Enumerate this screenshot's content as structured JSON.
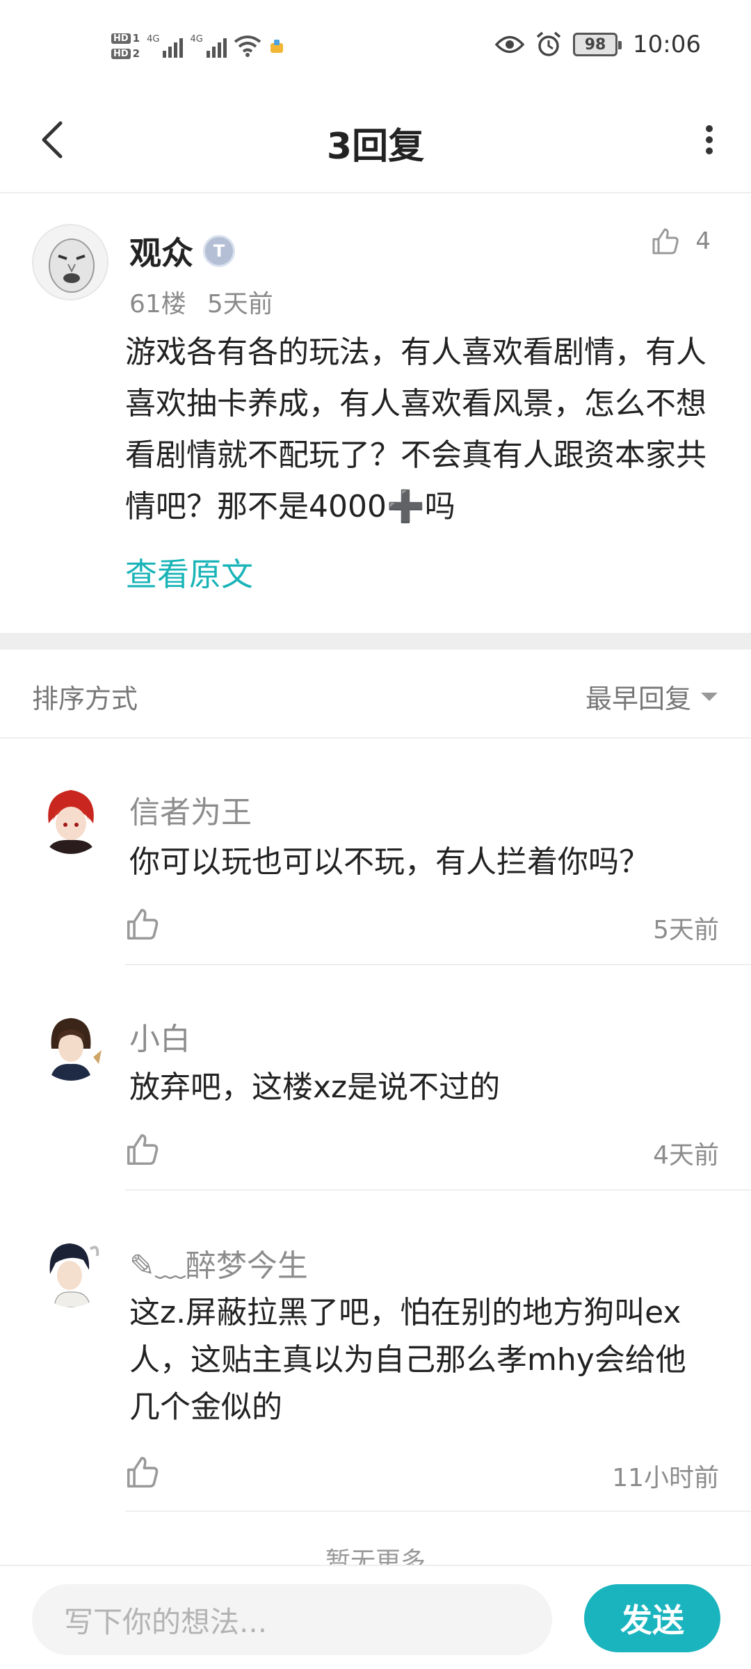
{
  "status_bar": {
    "hd1": "HD",
    "hd1_num": "1",
    "hd2": "HD",
    "hd2_num": "2",
    "net1": "4G",
    "net2": "4G",
    "battery": "98",
    "time": "10:06"
  },
  "header": {
    "title": "3回复"
  },
  "post": {
    "author": "观众",
    "level_badge": "T",
    "floor": "61楼",
    "time": "5天前",
    "likes": "4",
    "body": "游戏各有各的玩法，有人喜欢看剧情，有人喜欢抽卡养成，有人喜欢看风景，怎么不想看剧情就不配玩了？不会真有人跟资本家共情吧？那不是4000➕吗",
    "view_original": "查看原文"
  },
  "sort": {
    "label": "排序方式",
    "value": "最早回复"
  },
  "replies": [
    {
      "name": "信者为王",
      "text": "你可以玩也可以不玩，有人拦着你吗？",
      "time": "5天前"
    },
    {
      "name": "小白",
      "text": "放弃吧，这楼xz是说不过的",
      "time": "4天前"
    },
    {
      "name": "✎﹏醉梦今生",
      "text": "这z.屏蔽拉黑了吧，怕在别的地方狗叫ex人，这贴主真以为自己那么孝mhy会给他几个金似的",
      "time": "11小时前"
    }
  ],
  "no_more": "暂无更多",
  "composer": {
    "placeholder": "写下你的想法...",
    "send_label": "发送"
  },
  "colors": {
    "accent": "#1ab4bf",
    "link": "#19b4b8",
    "divider": "#eeeeee"
  },
  "icons": [
    "back-icon",
    "more-icon",
    "thumb-up-icon",
    "eye-icon",
    "alarm-icon",
    "wifi-icon",
    "battery-icon",
    "caret-down-icon"
  ]
}
